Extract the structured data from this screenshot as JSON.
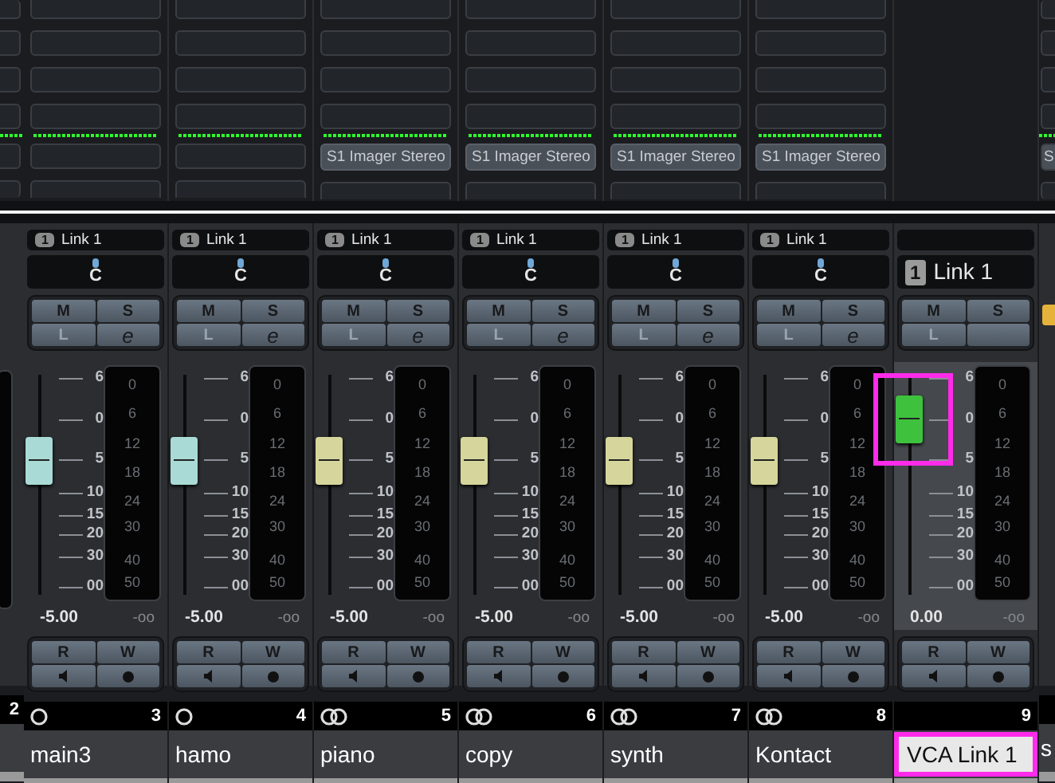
{
  "left_edge_strip": {
    "number": "2"
  },
  "strips": [
    {
      "kind": "audio",
      "name": "main3",
      "number": "3",
      "stereo": false,
      "selected": false,
      "highlighted": false,
      "insert_active": true,
      "link_badge": "1",
      "link": "Link 1",
      "pan": "C",
      "buttons": [
        {
          "label": "M",
          "disabled": false
        },
        {
          "label": "S",
          "disabled": false
        },
        {
          "label": "L",
          "disabled": true
        },
        {
          "label": "e",
          "disabled": false
        }
      ],
      "fader": {
        "level": 0.6,
        "color": "#a9dad6"
      },
      "fader_scale": [
        "6",
        "0",
        "5",
        "10",
        "15",
        "20",
        "30",
        "00"
      ],
      "meter_scale": [
        "0",
        "6",
        "12",
        "18",
        "24",
        "30",
        "40",
        "50"
      ],
      "volume": "-5.00",
      "peak": "-oo",
      "automation": [
        "R",
        "W"
      ]
    },
    {
      "kind": "audio",
      "name": "hamo",
      "number": "4",
      "stereo": false,
      "selected": false,
      "highlighted": false,
      "insert_active": true,
      "link_badge": "1",
      "link": "Link 1",
      "pan": "C",
      "buttons": [
        {
          "label": "M",
          "disabled": false
        },
        {
          "label": "S",
          "disabled": false
        },
        {
          "label": "L",
          "disabled": true
        },
        {
          "label": "e",
          "disabled": false
        }
      ],
      "fader": {
        "level": 0.6,
        "color": "#a9dad6"
      },
      "fader_scale": [
        "6",
        "0",
        "5",
        "10",
        "15",
        "20",
        "30",
        "00"
      ],
      "meter_scale": [
        "0",
        "6",
        "12",
        "18",
        "24",
        "30",
        "40",
        "50"
      ],
      "volume": "-5.00",
      "peak": "-oo",
      "automation": [
        "R",
        "W"
      ]
    },
    {
      "kind": "audio",
      "name": "piano",
      "number": "5",
      "stereo": true,
      "selected": false,
      "highlighted": false,
      "insert_active": true,
      "insert": "S1 Imager Stereo",
      "link_badge": "1",
      "link": "Link 1",
      "pan": "C",
      "buttons": [
        {
          "label": "M",
          "disabled": false
        },
        {
          "label": "S",
          "disabled": false
        },
        {
          "label": "L",
          "disabled": true
        },
        {
          "label": "e",
          "disabled": false
        }
      ],
      "fader": {
        "level": 0.6,
        "color": "#d6d69c"
      },
      "fader_scale": [
        "6",
        "0",
        "5",
        "10",
        "15",
        "20",
        "30",
        "00"
      ],
      "meter_scale": [
        "0",
        "6",
        "12",
        "18",
        "24",
        "30",
        "40",
        "50"
      ],
      "volume": "-5.00",
      "peak": "-oo",
      "automation": [
        "R",
        "W"
      ]
    },
    {
      "kind": "audio",
      "name": "copy",
      "number": "6",
      "stereo": true,
      "selected": false,
      "highlighted": false,
      "insert_active": true,
      "insert": "S1 Imager Stereo",
      "link_badge": "1",
      "link": "Link 1",
      "pan": "C",
      "buttons": [
        {
          "label": "M",
          "disabled": false
        },
        {
          "label": "S",
          "disabled": false
        },
        {
          "label": "L",
          "disabled": true
        },
        {
          "label": "e",
          "disabled": false
        }
      ],
      "fader": {
        "level": 0.6,
        "color": "#d6d69c"
      },
      "fader_scale": [
        "6",
        "0",
        "5",
        "10",
        "15",
        "20",
        "30",
        "00"
      ],
      "meter_scale": [
        "0",
        "6",
        "12",
        "18",
        "24",
        "30",
        "40",
        "50"
      ],
      "volume": "-5.00",
      "peak": "-oo",
      "automation": [
        "R",
        "W"
      ]
    },
    {
      "kind": "audio",
      "name": "synth",
      "number": "7",
      "stereo": true,
      "selected": false,
      "highlighted": false,
      "insert_active": true,
      "insert": "S1 Imager Stereo",
      "link_badge": "1",
      "link": "Link 1",
      "pan": "C",
      "buttons": [
        {
          "label": "M",
          "disabled": false
        },
        {
          "label": "S",
          "disabled": false
        },
        {
          "label": "L",
          "disabled": true
        },
        {
          "label": "e",
          "disabled": false
        }
      ],
      "fader": {
        "level": 0.6,
        "color": "#d6d69c"
      },
      "fader_scale": [
        "6",
        "0",
        "5",
        "10",
        "15",
        "20",
        "30",
        "00"
      ],
      "meter_scale": [
        "0",
        "6",
        "12",
        "18",
        "24",
        "30",
        "40",
        "50"
      ],
      "volume": "-5.00",
      "peak": "-oo",
      "automation": [
        "R",
        "W"
      ]
    },
    {
      "kind": "audio",
      "name": "Kontact",
      "number": "8",
      "stereo": true,
      "selected": false,
      "highlighted": false,
      "insert_active": true,
      "insert": "S1 Imager Stereo",
      "link_badge": "1",
      "link": "Link 1",
      "pan": "C",
      "buttons": [
        {
          "label": "M",
          "disabled": false
        },
        {
          "label": "S",
          "disabled": false
        },
        {
          "label": "L",
          "disabled": true
        },
        {
          "label": "e",
          "disabled": false
        }
      ],
      "fader": {
        "level": 0.6,
        "color": "#d6d69c"
      },
      "fader_scale": [
        "6",
        "0",
        "5",
        "10",
        "15",
        "20",
        "30",
        "00"
      ],
      "meter_scale": [
        "0",
        "6",
        "12",
        "18",
        "24",
        "30",
        "40",
        "50"
      ],
      "volume": "-5.00",
      "peak": "-oo",
      "automation": [
        "R",
        "W"
      ]
    },
    {
      "kind": "vca",
      "name": "VCA Link 1",
      "number": "9",
      "selected": true,
      "highlighted": true,
      "insert_active": false,
      "link_badge": "1",
      "link": "Link 1",
      "buttons": [
        {
          "label": "M",
          "disabled": false
        },
        {
          "label": "S",
          "disabled": false
        },
        {
          "label": "L",
          "disabled": true
        }
      ],
      "fader": {
        "level": 0.8,
        "color": "#3ec23e"
      },
      "fader_scale": [
        "6",
        "0",
        "5",
        "10",
        "15",
        "20",
        "30",
        "00"
      ],
      "meter_scale": [
        "0",
        "6",
        "12",
        "18",
        "24",
        "30",
        "40",
        "50"
      ],
      "volume": "0.00",
      "peak": "-oo",
      "automation": [
        "R",
        "W"
      ]
    }
  ],
  "right_edge_strip": {
    "insert": "S",
    "name": "s"
  }
}
